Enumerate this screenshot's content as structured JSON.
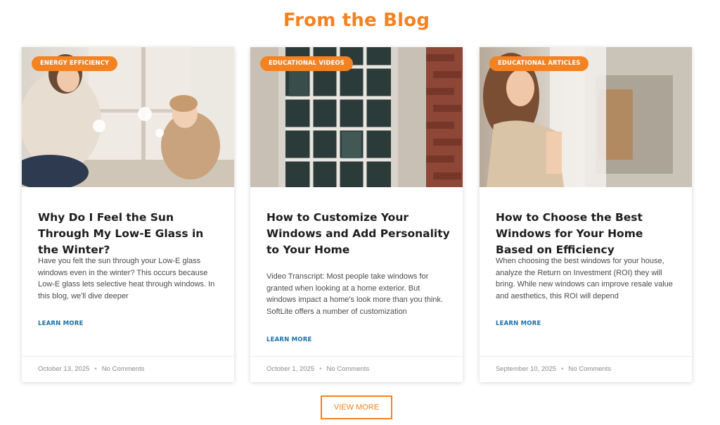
{
  "section": {
    "title": "From the Blog"
  },
  "posts": [
    {
      "category": "ENERGY EFFICIENCY",
      "title": "Why Do I Feel the Sun Through My Low-E Glass in the Winter?",
      "excerpt": "Have you felt the sun through your Low-E glass windows even in the winter? This occurs because Low-E glass lets selective heat through windows. In this blog, we'll dive deeper",
      "cta": "LEARN MORE",
      "date": "October 13, 2025",
      "comments": "No Comments"
    },
    {
      "category": "EDUCATIONAL VIDEOS",
      "title": "How to Customize Your Windows and Add Personality to Your Home",
      "excerpt": "Video Transcript: Most people take windows for granted when looking at a home exterior. But windows impact a home's look more than you think. SoftLite offers a number of customization",
      "cta": "LEARN MORE",
      "date": "October 1, 2025",
      "comments": "No Comments"
    },
    {
      "category": "EDUCATIONAL ARTICLES",
      "title": "How to Choose the Best Windows for Your Home Based on Efficiency",
      "excerpt": "When choosing the best windows for your house, analyze the Return on Investment (ROI) they will bring. While new windows can improve resale value and aesthetics, this ROI will depend",
      "cta": "LEARN MORE",
      "date": "September 10, 2025",
      "comments": "No Comments"
    }
  ],
  "view_more": {
    "label": "VIEW MORE"
  },
  "meta_separator": "•",
  "colors": {
    "accent": "#f58220",
    "link": "#1a6fa6",
    "text": "#1d1d1d",
    "muted": "#8a8a8a"
  }
}
